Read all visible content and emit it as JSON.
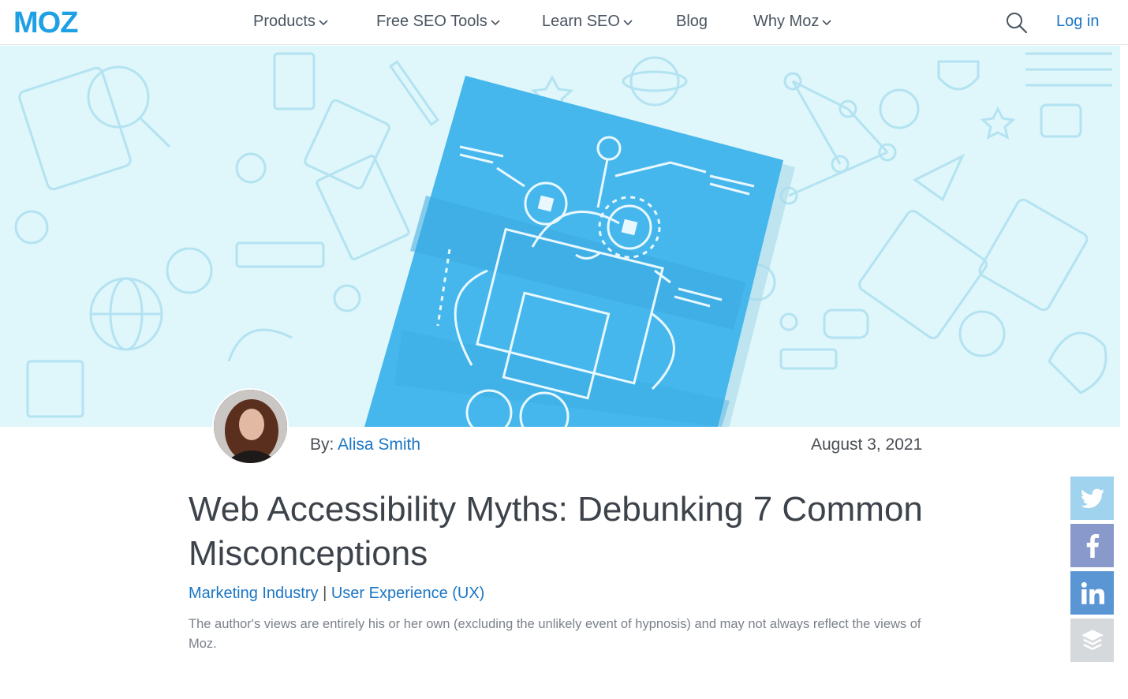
{
  "header": {
    "logo_text": "MOZ",
    "nav": [
      {
        "label": "Products",
        "dropdown": true
      },
      {
        "label": "Free SEO Tools",
        "dropdown": true
      },
      {
        "label": "Learn SEO",
        "dropdown": true
      },
      {
        "label": "Blog",
        "dropdown": false
      },
      {
        "label": "Why Moz",
        "dropdown": true
      }
    ],
    "login_label": "Log in",
    "search_icon": "search-icon"
  },
  "article": {
    "by_prefix": "By:",
    "author": "Alisa Smith",
    "date": "August 3, 2021",
    "title": "Web Accessibility Myths: Debunking 7 Common Misconceptions",
    "categories": [
      "Marketing Industry",
      "User Experience (UX)"
    ],
    "category_separator": "|",
    "disclaimer": "The author's views are entirely his or her own (excluding the unlikely event of hypnosis) and may not always reflect the views of Moz."
  },
  "share": [
    {
      "network": "twitter",
      "icon": "twitter-icon"
    },
    {
      "network": "facebook",
      "icon": "facebook-icon"
    },
    {
      "network": "linkedin",
      "icon": "linkedin-icon"
    },
    {
      "network": "buffer",
      "icon": "buffer-icon"
    }
  ],
  "colors": {
    "brand": "#1b76c5",
    "hero_bg": "#dff6fb",
    "hero_paper": "#45b7ec",
    "text": "#3d434a"
  }
}
